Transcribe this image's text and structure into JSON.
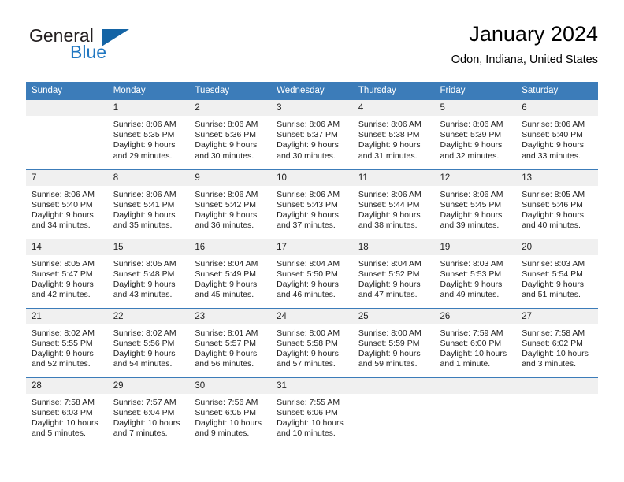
{
  "brand": {
    "name_part1": "General",
    "name_part2": "Blue",
    "triangle_color": "#1464a5",
    "blue_color": "#2077c1"
  },
  "header": {
    "title": "January 2024",
    "location": "Odon, Indiana, United States"
  },
  "theme": {
    "header_bar": "#3c7cb9",
    "daynum_band": "#f0f0f0",
    "text": "#222222"
  },
  "weekdays": [
    "Sunday",
    "Monday",
    "Tuesday",
    "Wednesday",
    "Thursday",
    "Friday",
    "Saturday"
  ],
  "weeks": [
    [
      {
        "day": "",
        "sunrise": "",
        "sunset": "",
        "daylight_line1": "",
        "daylight_line2": "",
        "blank": true
      },
      {
        "day": "1",
        "sunrise": "Sunrise: 8:06 AM",
        "sunset": "Sunset: 5:35 PM",
        "daylight_line1": "Daylight: 9 hours",
        "daylight_line2": "and 29 minutes."
      },
      {
        "day": "2",
        "sunrise": "Sunrise: 8:06 AM",
        "sunset": "Sunset: 5:36 PM",
        "daylight_line1": "Daylight: 9 hours",
        "daylight_line2": "and 30 minutes."
      },
      {
        "day": "3",
        "sunrise": "Sunrise: 8:06 AM",
        "sunset": "Sunset: 5:37 PM",
        "daylight_line1": "Daylight: 9 hours",
        "daylight_line2": "and 30 minutes."
      },
      {
        "day": "4",
        "sunrise": "Sunrise: 8:06 AM",
        "sunset": "Sunset: 5:38 PM",
        "daylight_line1": "Daylight: 9 hours",
        "daylight_line2": "and 31 minutes."
      },
      {
        "day": "5",
        "sunrise": "Sunrise: 8:06 AM",
        "sunset": "Sunset: 5:39 PM",
        "daylight_line1": "Daylight: 9 hours",
        "daylight_line2": "and 32 minutes."
      },
      {
        "day": "6",
        "sunrise": "Sunrise: 8:06 AM",
        "sunset": "Sunset: 5:40 PM",
        "daylight_line1": "Daylight: 9 hours",
        "daylight_line2": "and 33 minutes."
      }
    ],
    [
      {
        "day": "7",
        "sunrise": "Sunrise: 8:06 AM",
        "sunset": "Sunset: 5:40 PM",
        "daylight_line1": "Daylight: 9 hours",
        "daylight_line2": "and 34 minutes."
      },
      {
        "day": "8",
        "sunrise": "Sunrise: 8:06 AM",
        "sunset": "Sunset: 5:41 PM",
        "daylight_line1": "Daylight: 9 hours",
        "daylight_line2": "and 35 minutes."
      },
      {
        "day": "9",
        "sunrise": "Sunrise: 8:06 AM",
        "sunset": "Sunset: 5:42 PM",
        "daylight_line1": "Daylight: 9 hours",
        "daylight_line2": "and 36 minutes."
      },
      {
        "day": "10",
        "sunrise": "Sunrise: 8:06 AM",
        "sunset": "Sunset: 5:43 PM",
        "daylight_line1": "Daylight: 9 hours",
        "daylight_line2": "and 37 minutes."
      },
      {
        "day": "11",
        "sunrise": "Sunrise: 8:06 AM",
        "sunset": "Sunset: 5:44 PM",
        "daylight_line1": "Daylight: 9 hours",
        "daylight_line2": "and 38 minutes."
      },
      {
        "day": "12",
        "sunrise": "Sunrise: 8:06 AM",
        "sunset": "Sunset: 5:45 PM",
        "daylight_line1": "Daylight: 9 hours",
        "daylight_line2": "and 39 minutes."
      },
      {
        "day": "13",
        "sunrise": "Sunrise: 8:05 AM",
        "sunset": "Sunset: 5:46 PM",
        "daylight_line1": "Daylight: 9 hours",
        "daylight_line2": "and 40 minutes."
      }
    ],
    [
      {
        "day": "14",
        "sunrise": "Sunrise: 8:05 AM",
        "sunset": "Sunset: 5:47 PM",
        "daylight_line1": "Daylight: 9 hours",
        "daylight_line2": "and 42 minutes."
      },
      {
        "day": "15",
        "sunrise": "Sunrise: 8:05 AM",
        "sunset": "Sunset: 5:48 PM",
        "daylight_line1": "Daylight: 9 hours",
        "daylight_line2": "and 43 minutes."
      },
      {
        "day": "16",
        "sunrise": "Sunrise: 8:04 AM",
        "sunset": "Sunset: 5:49 PM",
        "daylight_line1": "Daylight: 9 hours",
        "daylight_line2": "and 45 minutes."
      },
      {
        "day": "17",
        "sunrise": "Sunrise: 8:04 AM",
        "sunset": "Sunset: 5:50 PM",
        "daylight_line1": "Daylight: 9 hours",
        "daylight_line2": "and 46 minutes."
      },
      {
        "day": "18",
        "sunrise": "Sunrise: 8:04 AM",
        "sunset": "Sunset: 5:52 PM",
        "daylight_line1": "Daylight: 9 hours",
        "daylight_line2": "and 47 minutes."
      },
      {
        "day": "19",
        "sunrise": "Sunrise: 8:03 AM",
        "sunset": "Sunset: 5:53 PM",
        "daylight_line1": "Daylight: 9 hours",
        "daylight_line2": "and 49 minutes."
      },
      {
        "day": "20",
        "sunrise": "Sunrise: 8:03 AM",
        "sunset": "Sunset: 5:54 PM",
        "daylight_line1": "Daylight: 9 hours",
        "daylight_line2": "and 51 minutes."
      }
    ],
    [
      {
        "day": "21",
        "sunrise": "Sunrise: 8:02 AM",
        "sunset": "Sunset: 5:55 PM",
        "daylight_line1": "Daylight: 9 hours",
        "daylight_line2": "and 52 minutes."
      },
      {
        "day": "22",
        "sunrise": "Sunrise: 8:02 AM",
        "sunset": "Sunset: 5:56 PM",
        "daylight_line1": "Daylight: 9 hours",
        "daylight_line2": "and 54 minutes."
      },
      {
        "day": "23",
        "sunrise": "Sunrise: 8:01 AM",
        "sunset": "Sunset: 5:57 PM",
        "daylight_line1": "Daylight: 9 hours",
        "daylight_line2": "and 56 minutes."
      },
      {
        "day": "24",
        "sunrise": "Sunrise: 8:00 AM",
        "sunset": "Sunset: 5:58 PM",
        "daylight_line1": "Daylight: 9 hours",
        "daylight_line2": "and 57 minutes."
      },
      {
        "day": "25",
        "sunrise": "Sunrise: 8:00 AM",
        "sunset": "Sunset: 5:59 PM",
        "daylight_line1": "Daylight: 9 hours",
        "daylight_line2": "and 59 minutes."
      },
      {
        "day": "26",
        "sunrise": "Sunrise: 7:59 AM",
        "sunset": "Sunset: 6:00 PM",
        "daylight_line1": "Daylight: 10 hours",
        "daylight_line2": "and 1 minute."
      },
      {
        "day": "27",
        "sunrise": "Sunrise: 7:58 AM",
        "sunset": "Sunset: 6:02 PM",
        "daylight_line1": "Daylight: 10 hours",
        "daylight_line2": "and 3 minutes."
      }
    ],
    [
      {
        "day": "28",
        "sunrise": "Sunrise: 7:58 AM",
        "sunset": "Sunset: 6:03 PM",
        "daylight_line1": "Daylight: 10 hours",
        "daylight_line2": "and 5 minutes."
      },
      {
        "day": "29",
        "sunrise": "Sunrise: 7:57 AM",
        "sunset": "Sunset: 6:04 PM",
        "daylight_line1": "Daylight: 10 hours",
        "daylight_line2": "and 7 minutes."
      },
      {
        "day": "30",
        "sunrise": "Sunrise: 7:56 AM",
        "sunset": "Sunset: 6:05 PM",
        "daylight_line1": "Daylight: 10 hours",
        "daylight_line2": "and 9 minutes."
      },
      {
        "day": "31",
        "sunrise": "Sunrise: 7:55 AM",
        "sunset": "Sunset: 6:06 PM",
        "daylight_line1": "Daylight: 10 hours",
        "daylight_line2": "and 10 minutes."
      },
      {
        "day": "",
        "sunrise": "",
        "sunset": "",
        "daylight_line1": "",
        "daylight_line2": "",
        "blank": true
      },
      {
        "day": "",
        "sunrise": "",
        "sunset": "",
        "daylight_line1": "",
        "daylight_line2": "",
        "blank": true
      },
      {
        "day": "",
        "sunrise": "",
        "sunset": "",
        "daylight_line1": "",
        "daylight_line2": "",
        "blank": true
      }
    ]
  ]
}
